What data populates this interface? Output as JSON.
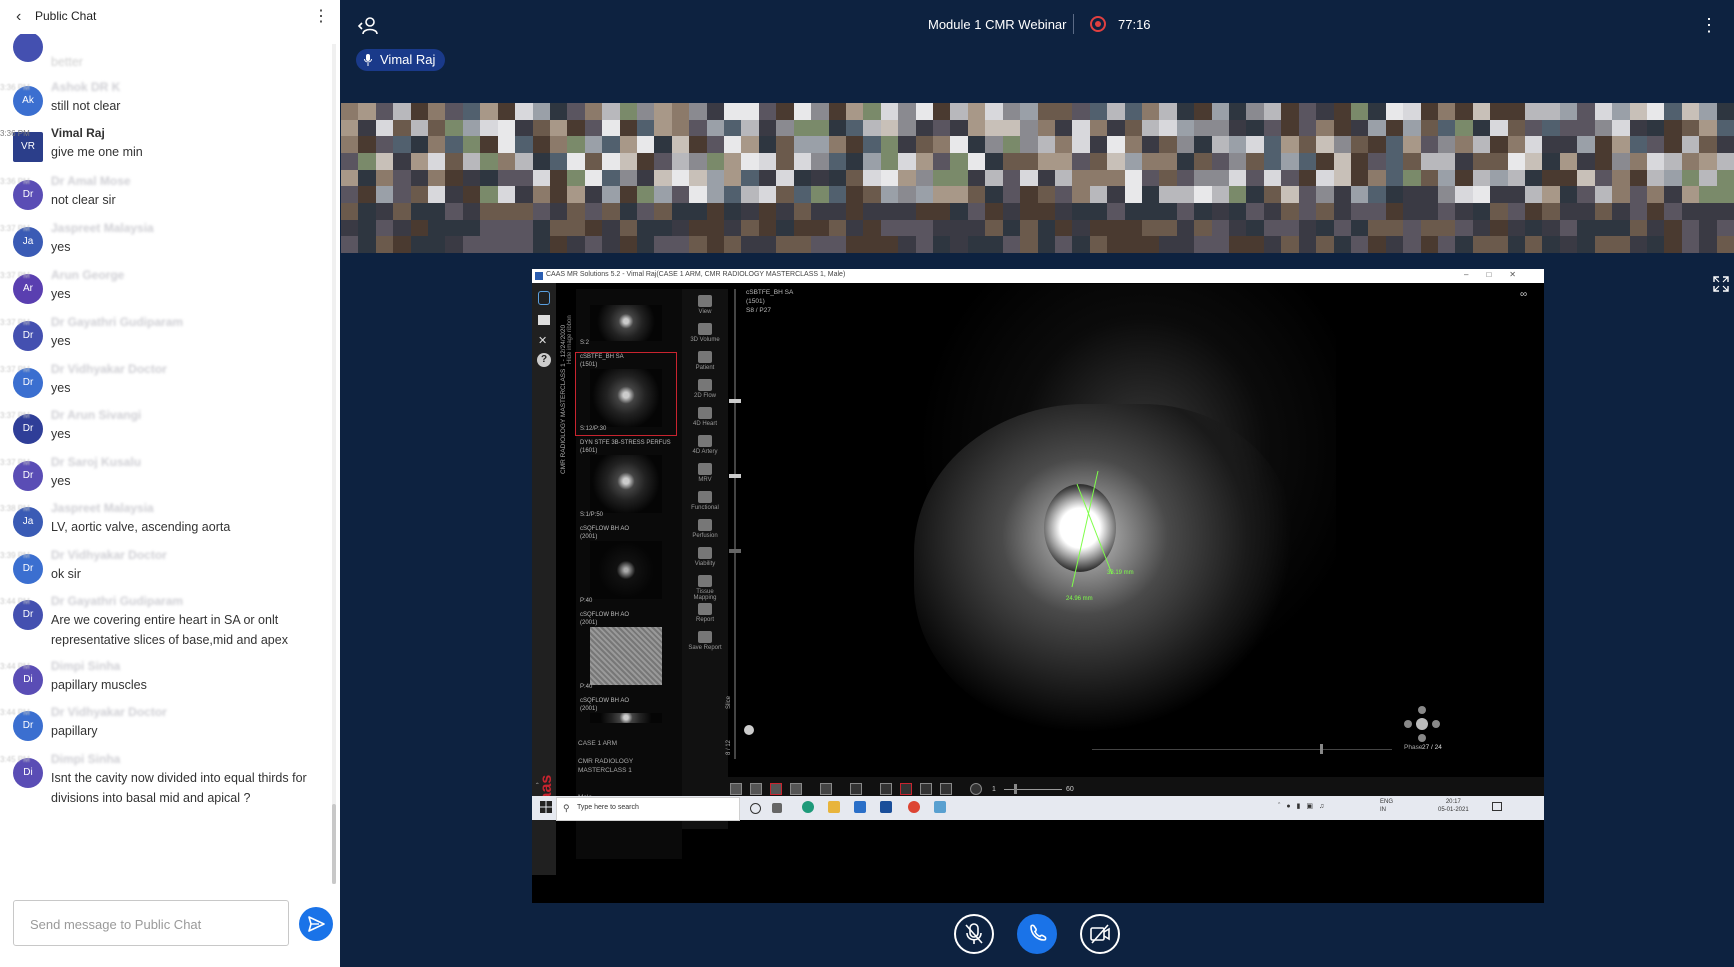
{
  "chat": {
    "title": "Public Chat",
    "input_placeholder": "Send message to Public Chat",
    "messages": [
      {
        "initials": "Ak",
        "sender": "Ashok DR K",
        "time": "3:36 PM",
        "text": "still not clear",
        "avatar_color": "#3b6fd0"
      },
      {
        "initials": "VR",
        "sender": "Vimal Raj",
        "time": "3:36 PM",
        "text": "give me one min",
        "avatar_color": "#2b3e8a"
      },
      {
        "initials": "Dr",
        "sender": "Dr Amal Mose",
        "time": "3:36 PM",
        "text": "not clear sir",
        "avatar_color": "#5a4db5"
      },
      {
        "initials": "Ja",
        "sender": "Jaspreet Malaysia",
        "time": "3:37 PM",
        "text": "yes",
        "avatar_color": "#3a5bb5"
      },
      {
        "initials": "Ar",
        "sender": "Arun George",
        "time": "3:37 PM",
        "text": "yes",
        "avatar_color": "#5a3fb0"
      },
      {
        "initials": "Dr",
        "sender": "Dr Gayathri Gudiparam",
        "time": "3:37 PM",
        "text": "yes",
        "avatar_color": "#4450b0"
      },
      {
        "initials": "Dr",
        "sender": "Dr Vidhyakar Doctor",
        "time": "3:37 PM",
        "text": "yes",
        "avatar_color": "#3b6fd0"
      },
      {
        "initials": "Dr",
        "sender": "Dr Arun Sivangi",
        "time": "3:37 PM",
        "text": "yes",
        "avatar_color": "#2f3e98"
      },
      {
        "initials": "Dr",
        "sender": "Dr Saroj Kusalu",
        "time": "3:37 PM",
        "text": "yes",
        "avatar_color": "#5a4db5"
      },
      {
        "initials": "Ja",
        "sender": "Jaspreet Malaysia",
        "time": "3:38 PM",
        "text": "LV, aortic valve, ascending aorta",
        "avatar_color": "#3a5bb5"
      },
      {
        "initials": "Dr",
        "sender": "Dr Vidhyakar Doctor",
        "time": "3:39 PM",
        "text": "ok sir",
        "avatar_color": "#3b6fd0"
      },
      {
        "initials": "Dr",
        "sender": "Dr Gayathri Gudiparam",
        "time": "3:44 PM",
        "text": "Are we covering entire heart in SA or onlt representative slices of base,mid and apex",
        "avatar_color": "#4450b0"
      },
      {
        "initials": "Di",
        "sender": "Dimpi Sinha",
        "time": "3:44 PM",
        "text": "papillary muscles",
        "avatar_color": "#5a4db5"
      },
      {
        "initials": "Dr",
        "sender": "Dr Vidhyakar Doctor",
        "time": "3:44 PM",
        "text": "papillary",
        "avatar_color": "#3b6fd0"
      },
      {
        "initials": "Di",
        "sender": "Dimpi Sinha",
        "time": "3:45 PM",
        "text": "Isnt the cavity now divided into equal thirds for divisions into basal mid and apical ?",
        "avatar_color": "#5a4db5"
      }
    ]
  },
  "meeting": {
    "title": "Module 1 CMR Webinar",
    "recording_time": "77:16",
    "presenter": "Vimal Raj",
    "colors": {
      "background": "#0d2240",
      "accent": "#1a73e8",
      "record": "#e04040"
    }
  },
  "shared_screen": {
    "window_title": "CAAS MR Solutions 5.2 - Vimal Raj(CASE 1 ARM, CMR RADIOLOGY MASTERCLASS 1, Male)",
    "vertical_label": "CMR RADIOLOGY MASTERCLASS 1 - 12/24/2020",
    "hide_image_ribbon": "Hide image ribbon",
    "brand": "Caas",
    "series_info": "cSBTFE_BH SA\n(1501)\nS8 / P27",
    "thumbnails": [
      {
        "label": "",
        "footer": "S:2"
      },
      {
        "label": "cSBTFE_BH SA\n(1501)",
        "footer": "S:12/P:30"
      },
      {
        "label": "DYN STFE 3B-STRESS PERFUS\n(1601)",
        "footer": "S:1/P:50"
      },
      {
        "label": "cSQFLOW BH AO\n(2001)",
        "footer": "P:40"
      },
      {
        "label": "cSQFLOW BH AO\n(2001)",
        "footer": "P:40"
      },
      {
        "label": "cSQFLOW BH AO\n(2001)",
        "footer": ""
      }
    ],
    "patient_info": "CASE 1 ARM\n\nCMR RADIOLOGY\nMASTERCLASS 1\n\n\nMale",
    "tools": [
      "View",
      "3D Volume",
      "Patient",
      "2D Flow",
      "4D Heart",
      "4D Artery",
      "MRV",
      "Functional",
      "Perfusion",
      "Viability",
      "Tissue Mapping",
      "Report",
      "Save Report"
    ],
    "measure_a": "33.19 mm",
    "measure_b": "24.96 mm",
    "slice_label": "Slice",
    "slice_value": "8 / 12",
    "phase_label": "Phase",
    "phase_value": "27 / 24",
    "range_lo": "1",
    "range_hi": "60",
    "taskbar": {
      "search_label": "Type here to search",
      "lang": "ENG\nIN",
      "clock": "20:17\n05-01-2021"
    }
  }
}
